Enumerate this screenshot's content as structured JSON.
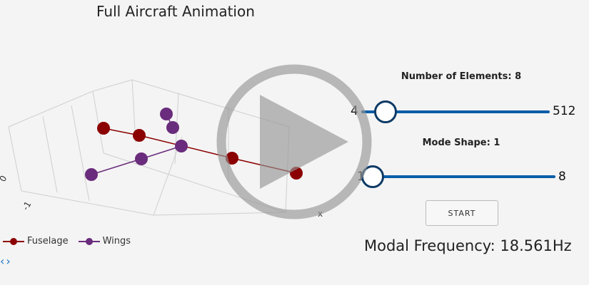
{
  "plot": {
    "title": "Full Aircraft Animation",
    "legend": [
      {
        "name": "Fuselage",
        "color": "#8b0000"
      },
      {
        "name": "Wings",
        "color": "#6a2c7c"
      }
    ],
    "tick_labels": [
      "0",
      "-1"
    ],
    "axis_x_label": "x"
  },
  "nav": {
    "prev": "‹",
    "next": "›"
  },
  "controls": {
    "elements_label": "Number of Elements: 8",
    "elements_min": "4",
    "elements_max": "512",
    "elements_fraction": 0.1,
    "mode_label": "Mode Shape: 1",
    "mode_min": "1",
    "mode_max": "8",
    "mode_fraction": 0.0,
    "start_label": "START"
  },
  "result": {
    "frequency_text": "Modal Frequency: 18.561Hz"
  },
  "colors": {
    "accent": "#0b5ea8",
    "thumb_border": "#0d3a66",
    "fuselage": "#8b0000",
    "wings": "#6a2c7c"
  },
  "icons": {
    "overlay": "play-icon"
  }
}
